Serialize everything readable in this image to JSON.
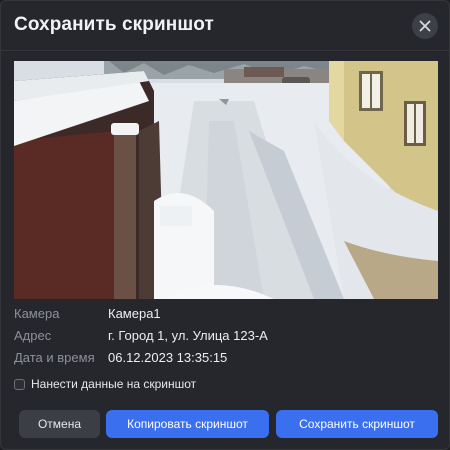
{
  "dialog": {
    "title": "Сохранить скриншот"
  },
  "info": {
    "camera_label": "Камера",
    "camera_value": "Камера1",
    "address_label": "Адрес",
    "address_value": "г. Город 1, ул. Улица 123-А",
    "datetime_label": "Дата и время",
    "datetime_value": "06.12.2023 13:35:15"
  },
  "options": {
    "overlay_checkbox_label": "Нанести данные на скриншот",
    "overlay_checked": false
  },
  "buttons": {
    "cancel": "Отмена",
    "copy": "Копировать скриншот",
    "save": "Сохранить скриншот"
  },
  "colors": {
    "accent": "#3a6ff0",
    "background": "#25272c"
  },
  "icons": {
    "close": "close-icon",
    "checkbox": "checkbox-icon"
  }
}
